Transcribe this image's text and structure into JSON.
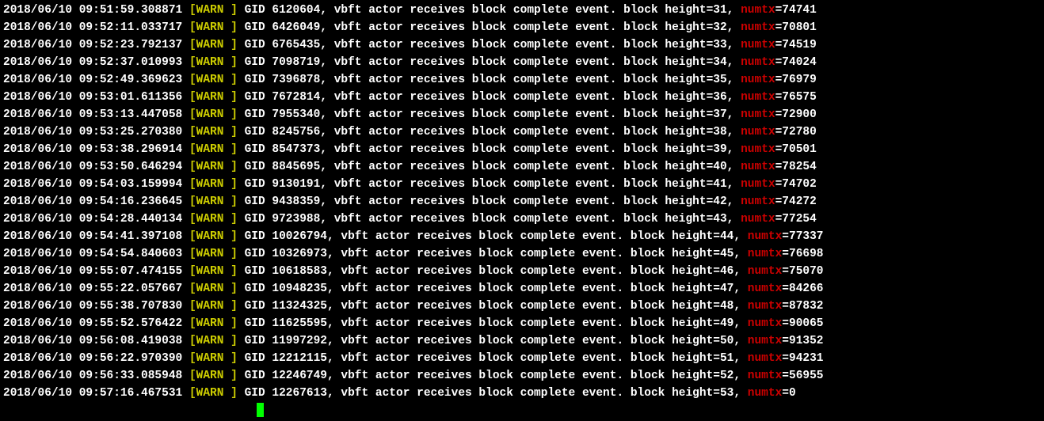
{
  "logs": [
    {
      "timestamp": "2018/06/10 09:51:59.308871",
      "level": "[WARN ]",
      "gid": "6120604",
      "height": "31",
      "numtx": "74741"
    },
    {
      "timestamp": "2018/06/10 09:52:11.033717",
      "level": "[WARN ]",
      "gid": "6426049",
      "height": "32",
      "numtx": "70801"
    },
    {
      "timestamp": "2018/06/10 09:52:23.792137",
      "level": "[WARN ]",
      "gid": "6765435",
      "height": "33",
      "numtx": "74519"
    },
    {
      "timestamp": "2018/06/10 09:52:37.010993",
      "level": "[WARN ]",
      "gid": "7098719",
      "height": "34",
      "numtx": "74024"
    },
    {
      "timestamp": "2018/06/10 09:52:49.369623",
      "level": "[WARN ]",
      "gid": "7396878",
      "height": "35",
      "numtx": "76979"
    },
    {
      "timestamp": "2018/06/10 09:53:01.611356",
      "level": "[WARN ]",
      "gid": "7672814",
      "height": "36",
      "numtx": "76575"
    },
    {
      "timestamp": "2018/06/10 09:53:13.447058",
      "level": "[WARN ]",
      "gid": "7955340",
      "height": "37",
      "numtx": "72900"
    },
    {
      "timestamp": "2018/06/10 09:53:25.270380",
      "level": "[WARN ]",
      "gid": "8245756",
      "height": "38",
      "numtx": "72780"
    },
    {
      "timestamp": "2018/06/10 09:53:38.296914",
      "level": "[WARN ]",
      "gid": "8547373",
      "height": "39",
      "numtx": "70501"
    },
    {
      "timestamp": "2018/06/10 09:53:50.646294",
      "level": "[WARN ]",
      "gid": "8845695",
      "height": "40",
      "numtx": "78254"
    },
    {
      "timestamp": "2018/06/10 09:54:03.159994",
      "level": "[WARN ]",
      "gid": "9130191",
      "height": "41",
      "numtx": "74702"
    },
    {
      "timestamp": "2018/06/10 09:54:16.236645",
      "level": "[WARN ]",
      "gid": "9438359",
      "height": "42",
      "numtx": "74272"
    },
    {
      "timestamp": "2018/06/10 09:54:28.440134",
      "level": "[WARN ]",
      "gid": "9723988",
      "height": "43",
      "numtx": "77254"
    },
    {
      "timestamp": "2018/06/10 09:54:41.397108",
      "level": "[WARN ]",
      "gid": "10026794",
      "height": "44",
      "numtx": "77337"
    },
    {
      "timestamp": "2018/06/10 09:54:54.840603",
      "level": "[WARN ]",
      "gid": "10326973",
      "height": "45",
      "numtx": "76698"
    },
    {
      "timestamp": "2018/06/10 09:55:07.474155",
      "level": "[WARN ]",
      "gid": "10618583",
      "height": "46",
      "numtx": "75070"
    },
    {
      "timestamp": "2018/06/10 09:55:22.057667",
      "level": "[WARN ]",
      "gid": "10948235",
      "height": "47",
      "numtx": "84266"
    },
    {
      "timestamp": "2018/06/10 09:55:38.707830",
      "level": "[WARN ]",
      "gid": "11324325",
      "height": "48",
      "numtx": "87832"
    },
    {
      "timestamp": "2018/06/10 09:55:52.576422",
      "level": "[WARN ]",
      "gid": "11625595",
      "height": "49",
      "numtx": "90065"
    },
    {
      "timestamp": "2018/06/10 09:56:08.419038",
      "level": "[WARN ]",
      "gid": "11997292",
      "height": "50",
      "numtx": "91352"
    },
    {
      "timestamp": "2018/06/10 09:56:22.970390",
      "level": "[WARN ]",
      "gid": "12212115",
      "height": "51",
      "numtx": "94231"
    },
    {
      "timestamp": "2018/06/10 09:56:33.085948",
      "level": "[WARN ]",
      "gid": "12246749",
      "height": "52",
      "numtx": "56955"
    },
    {
      "timestamp": "2018/06/10 09:57:16.467531",
      "level": "[WARN ]",
      "gid": "12267613",
      "height": "53",
      "numtx": "0"
    }
  ],
  "msg_template": {
    "prefix": " GID ",
    "middle": ", vbft actor receives block complete event. block height=",
    "sep": ", ",
    "numtx_label": "numtx",
    "eq": "="
  }
}
